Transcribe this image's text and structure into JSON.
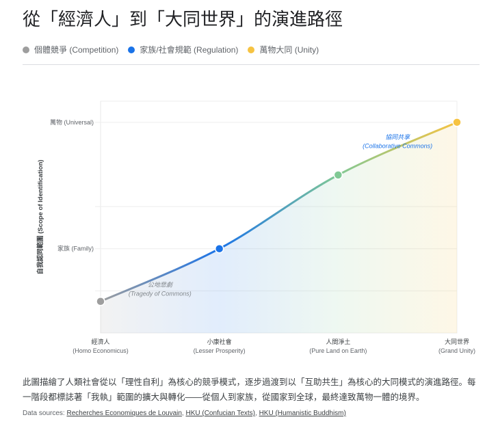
{
  "title": "從「經濟人」到「大同世界」的演進路徑",
  "legend": [
    {
      "label": "個體競爭 (Competition)",
      "color": "#9e9e9e"
    },
    {
      "label": "家族/社會規範 (Regulation)",
      "color": "#1a73e8"
    },
    {
      "label": "萬物大同 (Unity)",
      "color": "#f6c342"
    }
  ],
  "chart_data": {
    "type": "line",
    "ylabel": "自我認同範圍 (Scope of Identification)",
    "ylim": [
      0,
      5.5
    ],
    "grid_y": [
      1,
      2,
      3,
      5
    ],
    "y_ticks": [
      {
        "value": 5,
        "label": "萬物 (Universal)"
      },
      {
        "value": 2,
        "label": "家族 (Family)"
      }
    ],
    "categories": [
      {
        "zh": "經濟人",
        "en": "(Homo Economicus)"
      },
      {
        "zh": "小康社會",
        "en": "(Lesser Prosperity)"
      },
      {
        "zh": "人間淨土",
        "en": "(Pure Land on Earth)"
      },
      {
        "zh": "大同世界",
        "en": "(Grand Unity)"
      }
    ],
    "values": [
      0.75,
      2,
      3.75,
      5
    ],
    "point_colors": [
      "#9e9e9e",
      "#1a73e8",
      "#81c995",
      "#f6c342"
    ],
    "annotations": [
      {
        "x": 0.5,
        "y": 1.0,
        "zh": "公地悲劇",
        "en": "(Tragedy of Commons)",
        "color": "#80868b"
      },
      {
        "x": 2.5,
        "y": 4.5,
        "zh": "協同共享",
        "en": "(Collaborative Commons)",
        "color": "#1a73e8"
      }
    ]
  },
  "description": "此圖描繪了人類社會從以「理性自利」為核心的競爭模式，逐步過渡到以「互助共生」為核心的大同模式的演進路徑。每一階段都標誌著「我執」範圍的擴大與轉化——從個人到家族，從國家到全球，最終達致萬物一體的境界。",
  "sources": {
    "label": "Data sources:",
    "links": [
      "Recherches Economiques de Louvain",
      "HKU (Confucian Texts)",
      "HKU (Humanistic Buddhism)"
    ]
  }
}
